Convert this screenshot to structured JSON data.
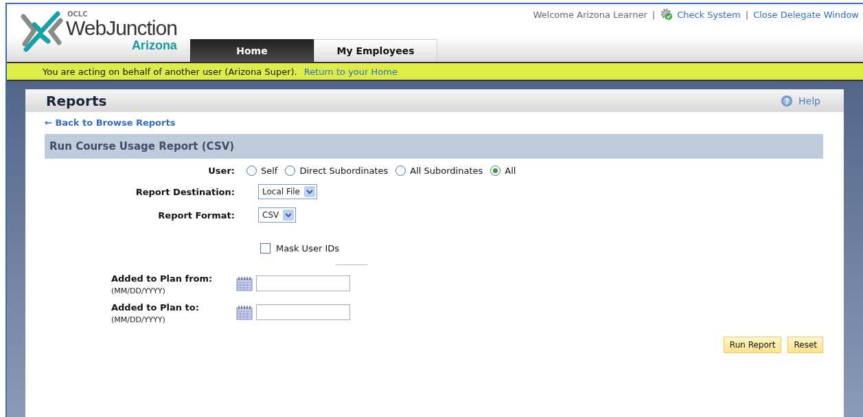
{
  "header": {
    "logo": {
      "org": "OCLC",
      "name": "WebJunction",
      "region": "Arizona"
    },
    "welcome": "Welcome Arizona Learner",
    "separator": "|",
    "links": [
      {
        "kind": "check",
        "label": "Check System"
      },
      {
        "kind": "plain",
        "label": "Close Delegate Window"
      }
    ]
  },
  "tabs": [
    {
      "label": "Home",
      "selected": true
    },
    {
      "label": "My Employees",
      "selected": false
    }
  ],
  "banner": {
    "text": "You are acting on behalf of another user (Arizona Super).",
    "link": "Return to your Home"
  },
  "page": {
    "title": "Reports",
    "help": "Help",
    "back": "← Back to Browse Reports",
    "section": "Run Course Usage Report (CSV)"
  },
  "form": {
    "user": {
      "label": "User:",
      "options": [
        {
          "label": "Self",
          "selected": false
        },
        {
          "label": "Direct Subordinates",
          "selected": false
        },
        {
          "label": "All Subordinates",
          "selected": false
        },
        {
          "label": "All",
          "selected": true
        }
      ]
    },
    "selects": [
      {
        "label": "Report Destination:",
        "value": "Local File"
      },
      {
        "label": "Report Format:",
        "value": "CSV"
      }
    ],
    "mask": {
      "label": "Mask User IDs",
      "checked": false
    },
    "dates": [
      {
        "label": "Added to Plan from:",
        "hint": "(MM/DD/YYYY)"
      },
      {
        "label": "Added to Plan to:",
        "hint": "(MM/DD/YYYY)"
      }
    ]
  },
  "buttons": [
    "Run Report",
    "Reset"
  ]
}
